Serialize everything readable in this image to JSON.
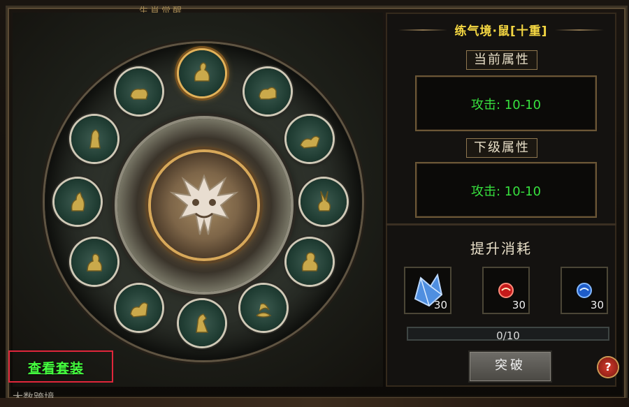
{
  "window": {
    "top_title": "生肖觉醒"
  },
  "left": {
    "view_set_label": "查看套装",
    "zodiac_icons": [
      "rat-figure-icon",
      "ox-figure-icon",
      "tiger-figure-icon",
      "rabbit-figure-icon",
      "dragon-figure-icon",
      "snake-figure-icon",
      "horse-figure-icon",
      "goat-figure-icon",
      "monkey-figure-icon",
      "rooster-figure-icon",
      "dog-figure-icon",
      "pig-figure-icon"
    ],
    "active_index": 0
  },
  "right": {
    "realm_title": "练气境·鼠[十重]",
    "current_attr_label": "当前属性",
    "current_attr_value": "攻击: 10-10",
    "next_attr_label": "下级属性",
    "next_attr_value": "攻击: 10-10",
    "cost_title": "提升消耗",
    "items": [
      {
        "icon": "blue-crystal-icon",
        "count": "30"
      },
      {
        "icon": "red-orb-icon",
        "count": "30"
      },
      {
        "icon": "blue-orb-icon",
        "count": "30"
      }
    ],
    "progress_text": "0/10",
    "progress_value": 0,
    "break_label": "突破",
    "help_label": "?"
  },
  "watermark": "大数跨境",
  "colors": {
    "accent_green": "#37e03e",
    "title_yellow": "#f5d742",
    "highlight_red": "#e0263b"
  }
}
